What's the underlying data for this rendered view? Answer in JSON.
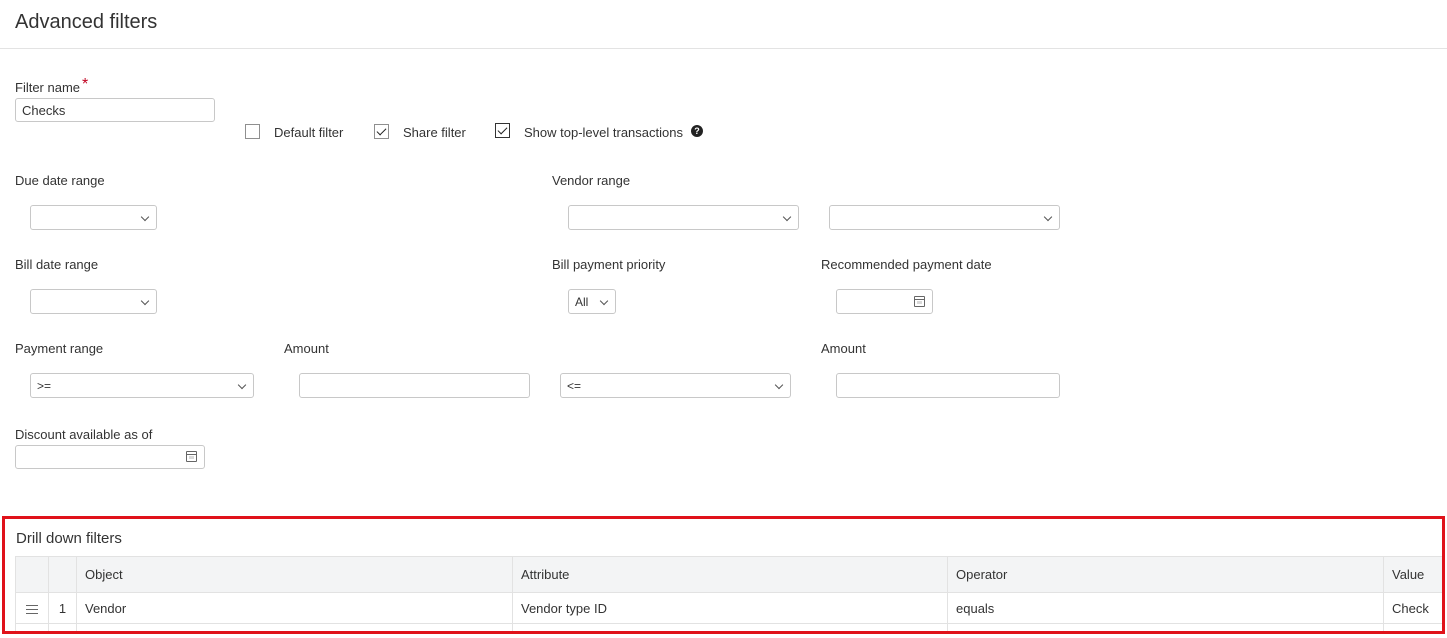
{
  "page": {
    "title": "Advanced filters"
  },
  "form": {
    "filter_name_label": "Filter name",
    "required_mark": "*",
    "filter_name_value": "Checks",
    "default_filter": {
      "label": "Default filter",
      "checked": false
    },
    "share_filter": {
      "label": "Share filter",
      "checked": true
    },
    "show_top_level": {
      "label": "Show top-level transactions",
      "checked": true
    },
    "due_date_range_label": "Due date range",
    "vendor_range_label": "Vendor range",
    "bill_date_range_label": "Bill date range",
    "bill_payment_priority_label": "Bill payment priority",
    "bill_payment_priority_value": "All",
    "recommended_payment_date_label": "Recommended payment date",
    "payment_range_label": "Payment range",
    "payment_range_from_op": ">=",
    "payment_range_to_op": "<=",
    "amount_label_1": "Amount",
    "amount_label_2": "Amount",
    "discount_label": "Discount available as of"
  },
  "drill_down": {
    "title": "Drill down filters",
    "columns": [
      "Object",
      "Attribute",
      "Operator",
      "Value"
    ],
    "rows": [
      {
        "index": "1",
        "object": "Vendor",
        "attribute": "Vendor type ID",
        "operator": "equals",
        "value": "Check"
      }
    ]
  },
  "icons": {
    "help": "question-circle-icon",
    "calendar": "calendar-icon",
    "chevron": "chevron-down-icon",
    "drag": "drag-handle-icon"
  },
  "colors": {
    "highlight_border": "#e0121a",
    "required": "#c0001f"
  }
}
